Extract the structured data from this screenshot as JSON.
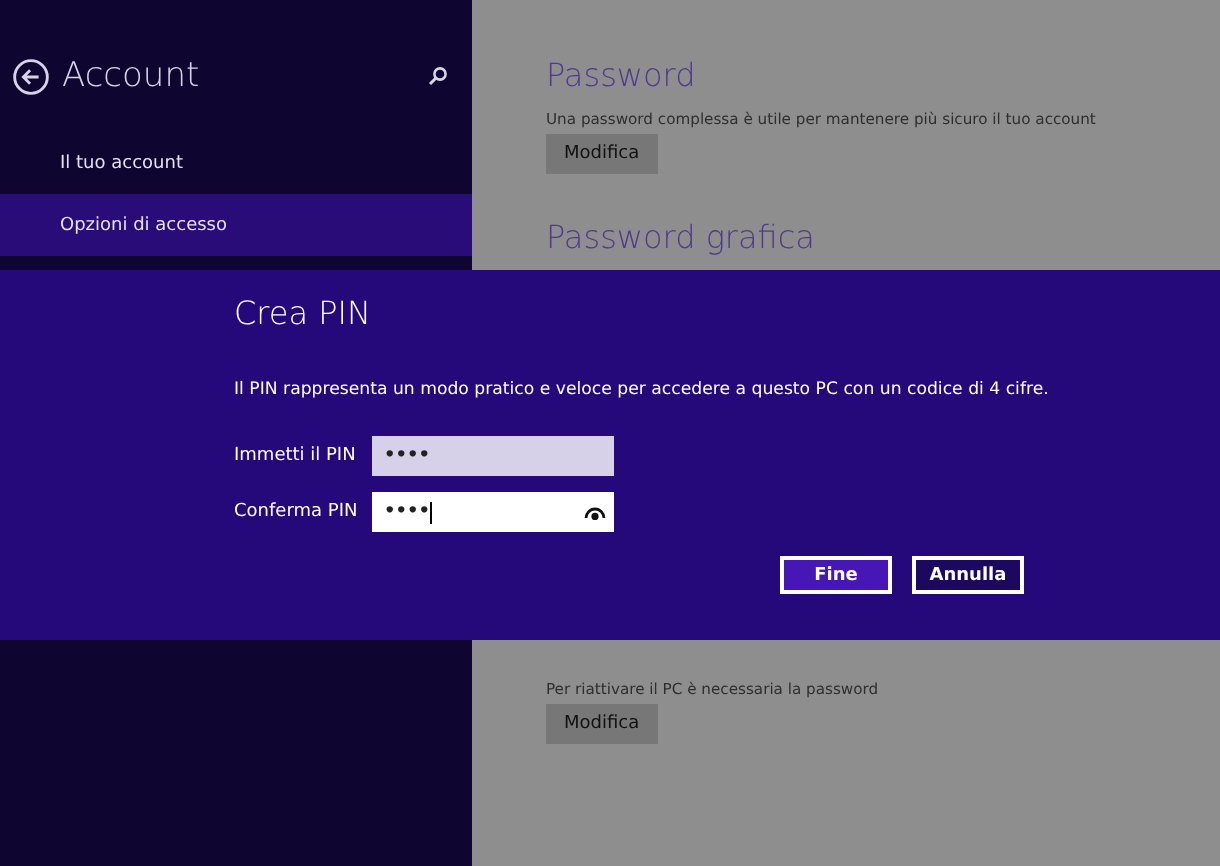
{
  "sidebar": {
    "title": "Account",
    "items": [
      {
        "label": "Il tuo account",
        "selected": false
      },
      {
        "label": "Opzioni di accesso",
        "selected": true
      }
    ]
  },
  "sections": [
    {
      "heading": "Password",
      "description": "Una password complessa è utile per mantenere più sicuro il tuo account",
      "button": "Modifica"
    },
    {
      "heading": "Password grafica"
    },
    {
      "description": "Per riattivare il PC è necessaria la password",
      "button": "Modifica"
    }
  ],
  "dialog": {
    "title": "Crea PIN",
    "message": "Il PIN rappresenta un modo pratico e veloce per accedere a questo PC con un codice di 4 cifre.",
    "fields": [
      {
        "label": "Immetti il PIN",
        "value": "••••",
        "focused": false
      },
      {
        "label": "Conferma PIN",
        "value": "••••",
        "focused": true
      }
    ],
    "buttons": [
      {
        "label": "Fine",
        "kind": "primary"
      },
      {
        "label": "Annulla",
        "kind": "secondary"
      }
    ]
  }
}
